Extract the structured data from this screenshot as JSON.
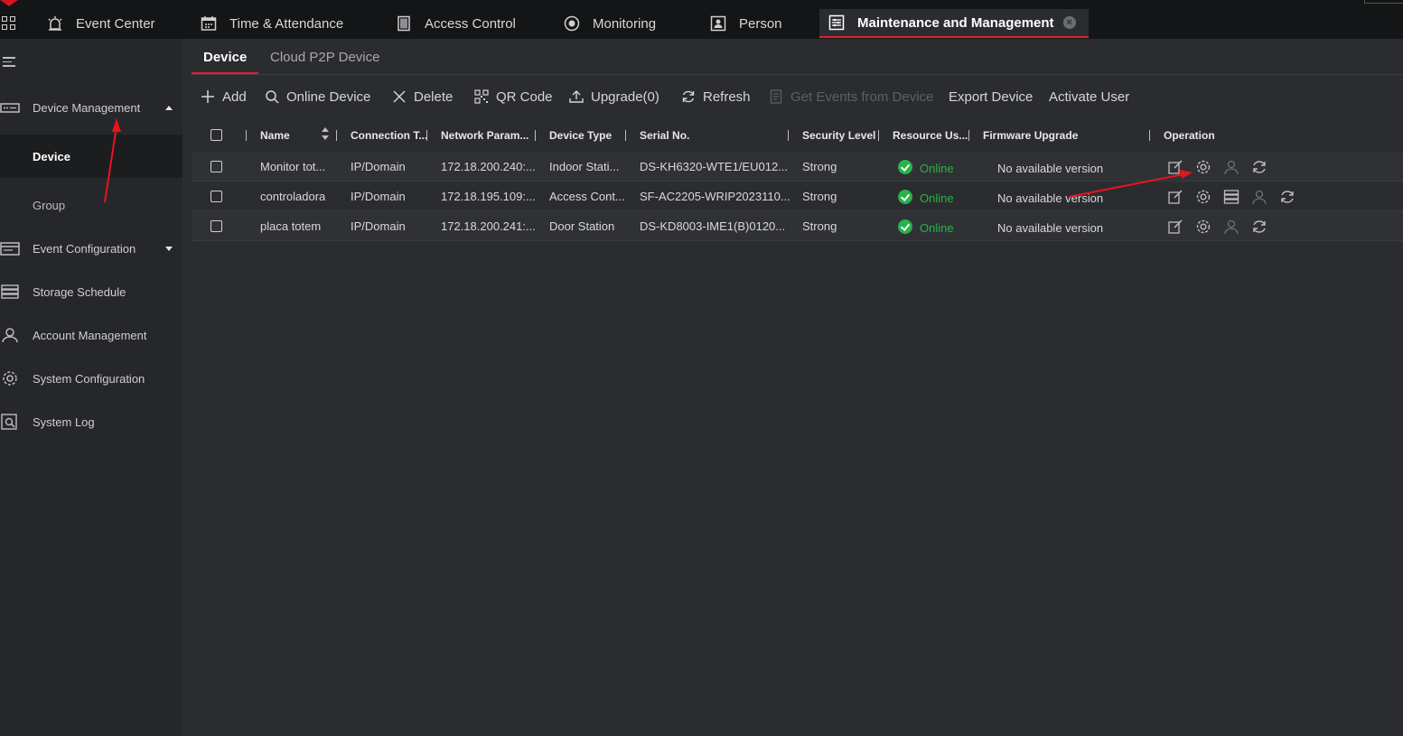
{
  "nav": {
    "tabs": [
      {
        "label": "Event Center",
        "icon": "alarm-icon"
      },
      {
        "label": "Time & Attendance",
        "icon": "calendar-icon"
      },
      {
        "label": "Access Control",
        "icon": "door-icon"
      },
      {
        "label": "Monitoring",
        "icon": "camera-icon"
      },
      {
        "label": "Person",
        "icon": "person-card-icon"
      },
      {
        "label": "Maintenance and Management",
        "icon": "settings-panel-icon"
      }
    ],
    "close": "×"
  },
  "sidebar": {
    "items": [
      {
        "label": "Device Management",
        "icon": "device-icon"
      },
      {
        "label": "Event Configuration",
        "icon": "event-config-icon"
      },
      {
        "label": "Storage Schedule",
        "icon": "storage-icon"
      },
      {
        "label": "Account Management",
        "icon": "account-icon"
      },
      {
        "label": "System Configuration",
        "icon": "gear-icon"
      },
      {
        "label": "System Log",
        "icon": "log-icon"
      }
    ],
    "subitems": [
      {
        "label": "Device"
      },
      {
        "label": "Group"
      }
    ]
  },
  "subtabs": [
    "Device",
    "Cloud P2P Device"
  ],
  "toolbar": {
    "add": "Add",
    "online_device": "Online Device",
    "delete": "Delete",
    "qr_code": "QR Code",
    "upgrade": "Upgrade(0)",
    "refresh": "Refresh",
    "get_events": "Get Events from Device",
    "export_device": "Export Device",
    "activate_user": "Activate User"
  },
  "table": {
    "headers": {
      "name": "Name",
      "connection": "Connection T...",
      "network": "Network Param...",
      "device_type": "Device Type",
      "serial": "Serial No.",
      "security": "Security Level",
      "resource": "Resource Us...",
      "firmware": "Firmware Upgrade",
      "operation": "Operation"
    },
    "rows": [
      {
        "name": "Monitor tot...",
        "connection": "IP/Domain",
        "network": "172.18.200.240:...",
        "device_type": "Indoor Stati...",
        "serial": "DS-KH6320-WTE1/EU012...",
        "security": "Strong",
        "status": "Online",
        "firmware": "No available version"
      },
      {
        "name": "controladora",
        "connection": "IP/Domain",
        "network": "172.18.195.109:...",
        "device_type": "Access Cont...",
        "serial": "SF-AC2205-WRIP2023110...",
        "security": "Strong",
        "status": "Online",
        "firmware": "No available version"
      },
      {
        "name": "placa totem",
        "connection": "IP/Domain",
        "network": "172.18.200.241:...",
        "device_type": "Door Station",
        "serial": "DS-KD8003-IME1(B)0120...",
        "security": "Strong",
        "status": "Online",
        "firmware": "No available version"
      }
    ]
  },
  "colors": {
    "accent": "#e0222a",
    "online": "#27b34a",
    "annotation_arrow": "#e8141c"
  }
}
